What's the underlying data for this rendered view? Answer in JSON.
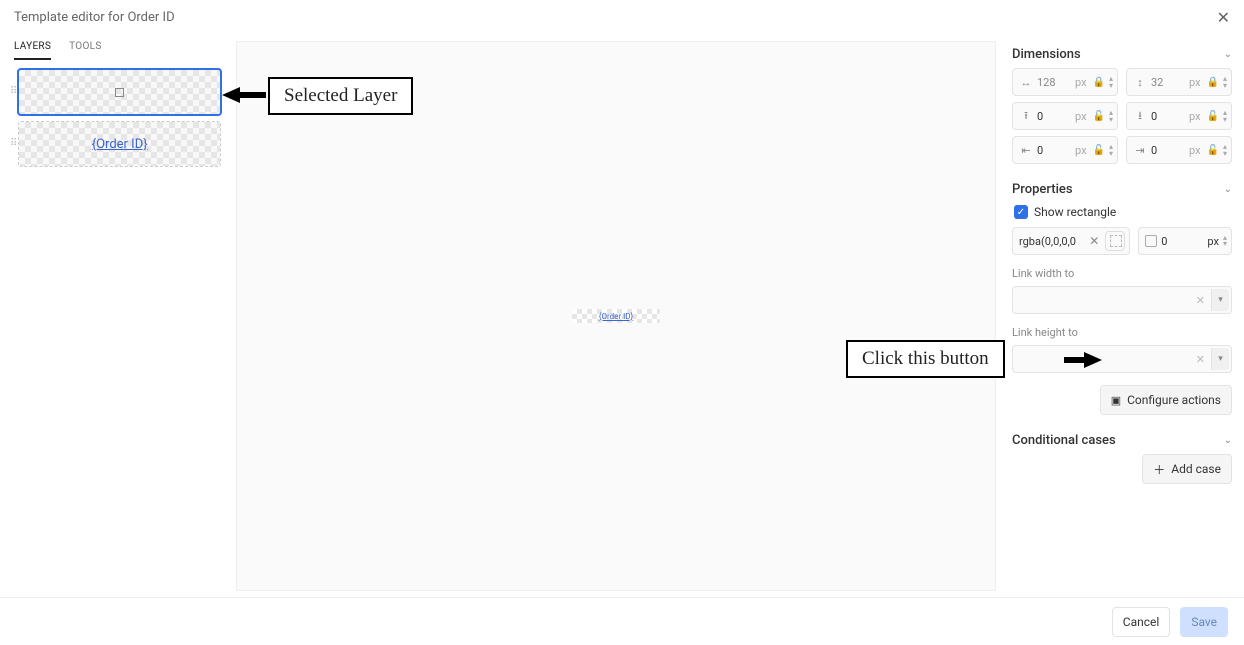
{
  "title": "Template editor for Order ID",
  "tabs": {
    "layers": "LAYERS",
    "tools": "TOOLS"
  },
  "layers": [
    {
      "kind": "rect",
      "selected": true
    },
    {
      "kind": "link",
      "label": "{Order ID}",
      "selected": false
    }
  ],
  "canvas": {
    "placeholder": "{Order ID}"
  },
  "dimensions": {
    "heading": "Dimensions",
    "width": {
      "value": "128",
      "unit": "px",
      "locked": true
    },
    "height": {
      "value": "32",
      "unit": "px",
      "locked": true
    },
    "pad_top": {
      "value": "0",
      "unit": "px",
      "locked": false
    },
    "pad_bottom": {
      "value": "0",
      "unit": "px",
      "locked": false
    },
    "pad_left": {
      "value": "0",
      "unit": "px",
      "locked": false
    },
    "pad_right": {
      "value": "0",
      "unit": "px",
      "locked": false
    }
  },
  "properties": {
    "heading": "Properties",
    "show_rectangle_label": "Show rectangle",
    "show_rectangle": true,
    "fill": "rgba(0,0,0,0",
    "border_width": {
      "value": "0",
      "unit": "px"
    },
    "link_width_label": "Link width to",
    "link_height_label": "Link height to",
    "configure_actions": "Configure actions"
  },
  "conditional": {
    "heading": "Conditional cases",
    "add_case": "Add case"
  },
  "footer": {
    "cancel": "Cancel",
    "save": "Save"
  },
  "annotations": {
    "selected_layer": "Selected Layer",
    "click_button": "Click this button"
  }
}
